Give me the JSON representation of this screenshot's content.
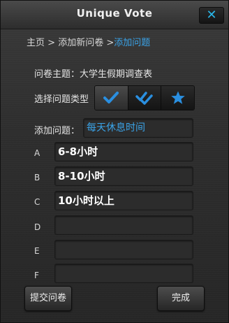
{
  "window": {
    "title": "Unique Vote",
    "close_label": "✕"
  },
  "breadcrumb": {
    "home": "主页",
    "sep1": " > ",
    "step2": "添加新问卷",
    "sep2": " >",
    "current": "添加问题"
  },
  "survey": {
    "topic_label": "问卷主题：",
    "topic_value": "大学生假期调查表"
  },
  "question_type": {
    "label": "选择问题类型",
    "options": [
      {
        "icon": "single-check-icon",
        "selected": true
      },
      {
        "icon": "double-check-icon",
        "selected": false
      },
      {
        "icon": "star-icon",
        "selected": false
      }
    ],
    "accent": "#2a8fe0"
  },
  "question": {
    "label": "添加问题：",
    "value": "每天休息时间"
  },
  "options": [
    {
      "letter": "A",
      "value": "6-8小时"
    },
    {
      "letter": "B",
      "value": "8-10小时"
    },
    {
      "letter": "C",
      "value": "10小时以上"
    },
    {
      "letter": "D",
      "value": ""
    },
    {
      "letter": "E",
      "value": ""
    },
    {
      "letter": "F",
      "value": ""
    }
  ],
  "buttons": {
    "submit": "提交问卷",
    "done": "完成"
  }
}
